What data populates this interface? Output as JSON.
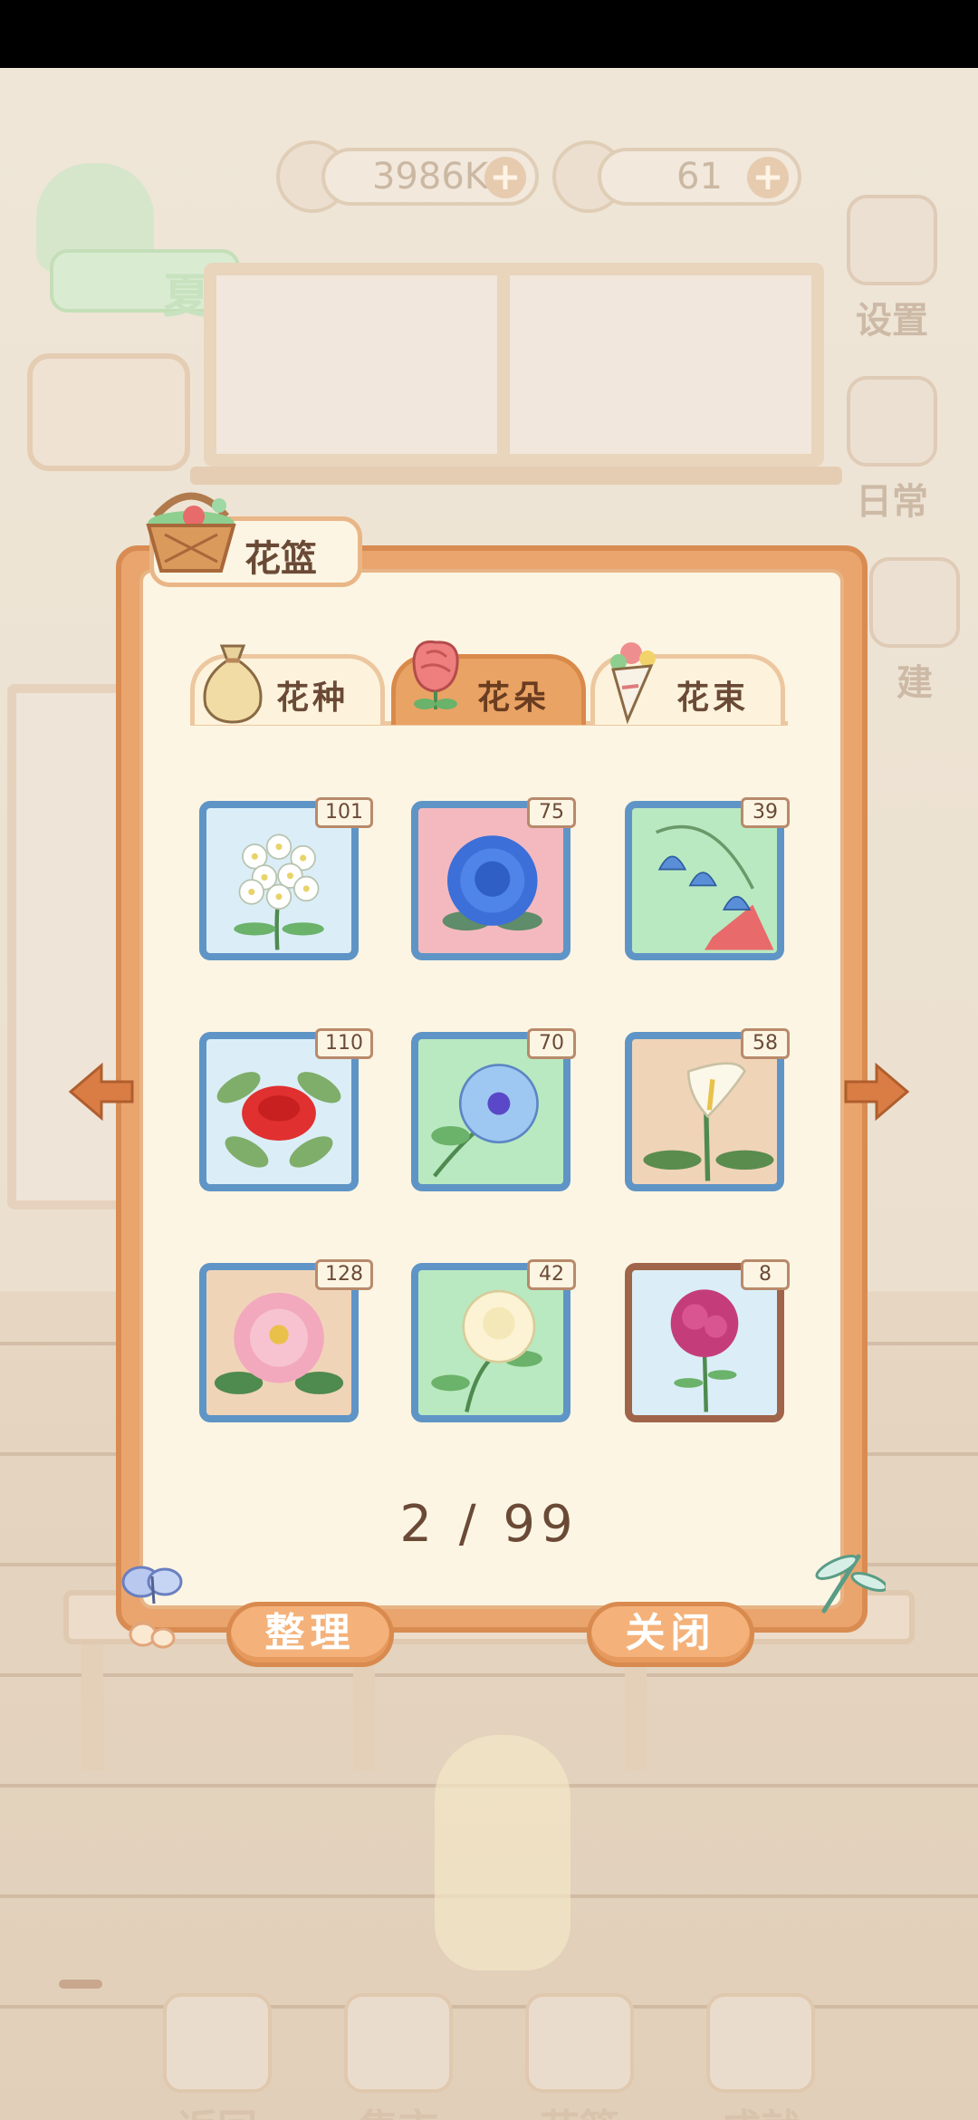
{
  "background": {
    "logo_text": "夏",
    "currency_fish": "3986K",
    "currency_cheese": "61",
    "side_buttons": [
      "设置",
      "日常",
      "建"
    ],
    "bottom_nav": [
      "返回",
      "集市",
      "花篮",
      "成就"
    ]
  },
  "modal": {
    "title": "花篮",
    "tabs": [
      {
        "label": "花种",
        "icon": "seed-bag-icon",
        "active": false
      },
      {
        "label": "花朵",
        "icon": "rose-icon",
        "active": true
      },
      {
        "label": "花束",
        "icon": "bouquet-icon",
        "active": false
      }
    ],
    "items": [
      {
        "name": "white-jasmine-flower",
        "count": "101",
        "bg": "#dbeef7"
      },
      {
        "name": "blue-peony-flower",
        "count": "75",
        "bg": "#f4b9bf"
      },
      {
        "name": "blue-bellflower-flower",
        "count": "39",
        "bg": "#b9e9c0"
      },
      {
        "name": "red-camellia-flower",
        "count": "110",
        "bg": "#dbeef7"
      },
      {
        "name": "morning-glory-flower",
        "count": "70",
        "bg": "#b9e9c0"
      },
      {
        "name": "calla-lily-flower",
        "count": "58",
        "bg": "#f0d4b8"
      },
      {
        "name": "pink-peony-flower",
        "count": "128",
        "bg": "#f0d4b8"
      },
      {
        "name": "white-rose-flower",
        "count": "42",
        "bg": "#b9e9c0"
      },
      {
        "name": "carnation-flower",
        "count": "8",
        "bg": "#dbeef7"
      }
    ],
    "page": "2 / 99",
    "sort_button": "整理",
    "close_button": "关闭"
  },
  "colors": {
    "modal_border": "#e9a56d",
    "panel_bg": "#fdf5e3",
    "slot_border": "#5f95c6",
    "slot_border_selected": "#a0644a",
    "text": "#6a4a36"
  }
}
